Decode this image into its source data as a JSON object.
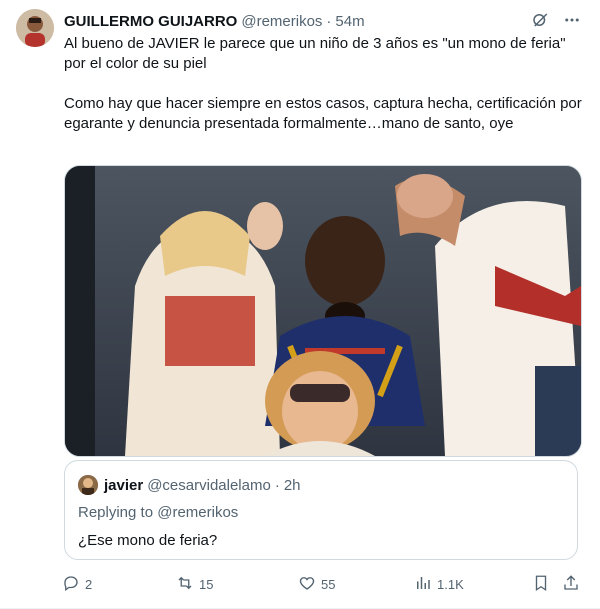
{
  "tweet": {
    "author_name": "GUILLERMO GUIJARRO",
    "author_handle": "@remerikos",
    "dot": "·",
    "time": "54m",
    "text_p1": "Al bueno de JAVIER le parece que un niño de 3 años es \"un mono de feria\" por el color de su piel",
    "text_p2": "Como hay que hacer siempre en estos casos, captura hecha, certificación por egarante y denuncia presentada formalmente…mano de santo, oye"
  },
  "quote": {
    "name": "javier",
    "handle": "@cesarvidalelamo",
    "dot": "·",
    "time": "2h",
    "replying_prefix": "Replying to ",
    "replying_to": "@remerikos",
    "text": "¿Ese mono de feria?"
  },
  "actions": {
    "replies": "2",
    "reposts": "15",
    "likes": "55",
    "views": "1.1K"
  },
  "icons": {
    "header": [
      "grok-icon",
      "more-icon"
    ],
    "actions": [
      "reply-icon",
      "repost-icon",
      "like-icon",
      "views-icon",
      "bookmark-icon",
      "share-icon"
    ]
  },
  "colors": {
    "text_primary": "#0f1419",
    "text_secondary": "#536471",
    "border": "#cfd9de"
  }
}
